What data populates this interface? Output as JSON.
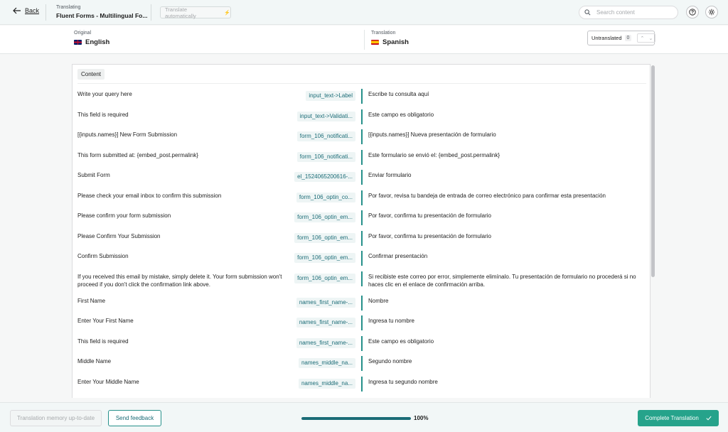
{
  "header": {
    "back_label": "Back",
    "subtitle": "Translating",
    "title": "Fluent Forms - Multilingual Fo...",
    "auto_translate_label": "Translate automatically",
    "search_placeholder": "Search content"
  },
  "languages": {
    "original_label": "Original",
    "original_name": "English",
    "translation_label": "Translation",
    "translation_name": "Spanish",
    "filter_label": "Untranslated",
    "filter_count": "0"
  },
  "content": {
    "section_label": "Content",
    "rows": [
      {
        "source": "Write your query here",
        "key": "input_text->Label",
        "target": "Escribe tu consulta aquí"
      },
      {
        "source": "This field is required",
        "key": "input_text->Validati...",
        "target": "Este campo es obligatorio"
      },
      {
        "source": "[{inputs.names}] New Form Submission",
        "key": "form_106_notificati...",
        "target": "[{inputs.names}] Nueva presentación de formulario"
      },
      {
        "source": "This form submitted at: {embed_post.permalink}",
        "key": "form_106_notificati...",
        "target": "Este formulario se envió el: {embed_post.permalink}"
      },
      {
        "source": "Submit Form",
        "key": "el_1524065200616-...",
        "target": "Enviar formulario"
      },
      {
        "source": "Please check your email inbox to confirm this submission",
        "key": "form_106_optin_co...",
        "target": "Por favor, revisa tu bandeja de entrada de correo electrónico para confirmar esta presentación"
      },
      {
        "source": "Please confirm your form submission",
        "key": "form_106_optin_em...",
        "target": "Por favor, confirma tu presentación de formulario"
      },
      {
        "source": "Please Confirm Your Submission",
        "key": "form_106_optin_em...",
        "target": "Por favor, confirma tu presentación de formulario"
      },
      {
        "source": "Confirm Submission",
        "key": "form_106_optin_em...",
        "target": "Confirmar presentación"
      },
      {
        "source": "If you received this email by mistake, simply delete it. Your form submission won't proceed if you don't click the confirmation link above.",
        "key": "form_106_optin_em...",
        "target": "Si recibiste este correo por error, simplemente elimínalo. Tu presentación de formulario no procederá si no haces clic en el enlace de confirmación arriba."
      },
      {
        "source": "First Name",
        "key": "names_first_name-...",
        "target": "Nombre"
      },
      {
        "source": "Enter Your First Name",
        "key": "names_first_name-...",
        "target": "Ingresa tu nombre"
      },
      {
        "source": "This field is required",
        "key": "names_first_name-...",
        "target": "Este campo es obligatorio"
      },
      {
        "source": "Middle Name",
        "key": "names_middle_na...",
        "target": "Segundo nombre"
      },
      {
        "source": "Enter Your Middle Name",
        "key": "names_middle_na...",
        "target": "Ingresa tu segundo nombre"
      }
    ]
  },
  "footer": {
    "memory_label": "Translation memory up-to-date",
    "feedback_label": "Send feedback",
    "progress_percent": 100,
    "progress_text": "100%",
    "complete_label": "Complete Translation"
  },
  "colors": {
    "accent": "#26a38b",
    "key_text": "#1b6c77",
    "divider_bar": "#26908a"
  },
  "icons": [
    "arrow-left-icon",
    "bolt-icon",
    "search-icon",
    "help-icon",
    "gear-icon",
    "uk-flag-icon",
    "spain-flag-icon",
    "chevron-up-icon",
    "chevron-down-icon",
    "check-icon"
  ]
}
